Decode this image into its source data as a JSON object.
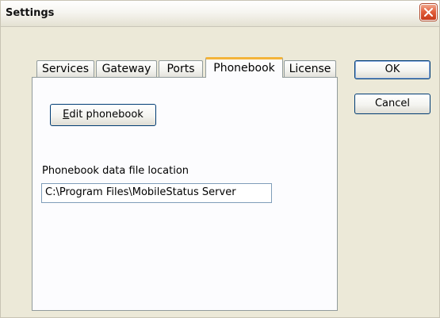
{
  "window": {
    "title": "Settings"
  },
  "tabs": [
    {
      "label": "Services",
      "active": false
    },
    {
      "label": "Gateway",
      "active": false
    },
    {
      "label": "Ports",
      "active": false
    },
    {
      "label": "Phonebook",
      "active": true
    },
    {
      "label": "License",
      "active": false
    }
  ],
  "phonebook": {
    "edit_button": {
      "mnemonic": "E",
      "rest": "dit phonebook"
    },
    "location_label": "Phonebook data file location",
    "location_value": "C:\\Program Files\\MobileStatus Server"
  },
  "buttons": {
    "ok": "OK",
    "cancel": "Cancel"
  },
  "colors": {
    "active_tab_accent": "#f3b43a",
    "close_button": "#e2603d"
  }
}
